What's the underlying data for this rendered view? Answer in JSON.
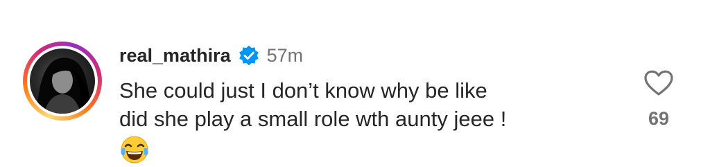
{
  "previous_comment": {
    "clipped_text": "· · · · ·"
  },
  "comment": {
    "username": "real_mathira",
    "verified": true,
    "timestamp": "57m",
    "text_line_1": "She could just I don’t know why be like",
    "text_line_2": "did she play a small role wth aunty jeee !",
    "emoji": "face-with-tears-of-joy",
    "likes": "69"
  },
  "icons": {
    "avatar": "avatar-icon",
    "verified": "verified-badge-icon",
    "like": "heart-outline-icon",
    "emoji": "laughing-emoji-icon"
  },
  "colors": {
    "text_primary": "#262626",
    "text_secondary": "#737373",
    "verified_blue": "#0095f6",
    "story_ring": [
      "#feda75",
      "#fa7e1e",
      "#d62976",
      "#962fbf"
    ]
  }
}
